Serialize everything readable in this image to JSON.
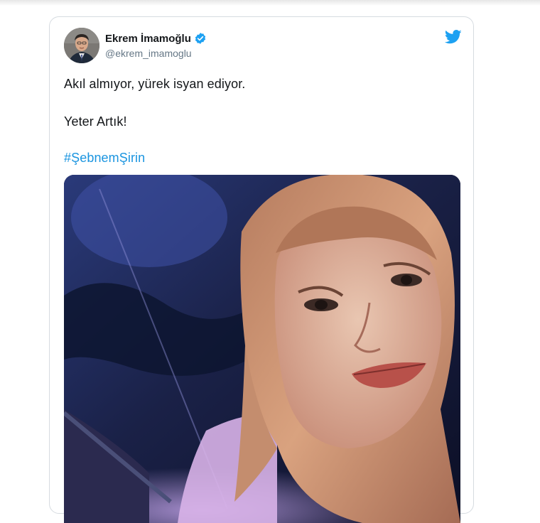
{
  "tweet": {
    "author_name": "Ekrem İmamoğlu",
    "author_handle": "@ekrem_imamoglu",
    "verified": true,
    "lines": [
      "Akıl almıyor, yürek isyan ediyor.",
      "Yeter Artık!"
    ],
    "hashtag": "#ŞebnemŞirin"
  },
  "icons": {
    "verified": "verified-badge-icon",
    "brand": "twitter-bird-icon"
  },
  "colors": {
    "link": "#1b95e0",
    "verified_badge": "#1da1f2",
    "text": "#14171a",
    "secondary_text": "#657786",
    "border": "#d6dbe0"
  }
}
